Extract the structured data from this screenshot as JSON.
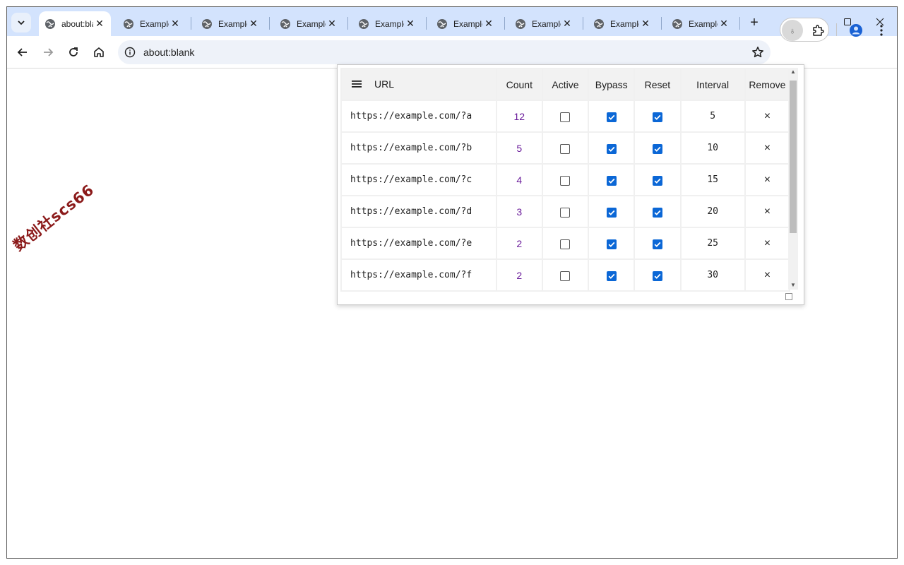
{
  "browser": {
    "tabs": [
      {
        "title": "about:blank",
        "active": true
      },
      {
        "title": "Example Domain",
        "active": false
      },
      {
        "title": "Example Domain",
        "active": false
      },
      {
        "title": "Example Domain",
        "active": false
      },
      {
        "title": "Example Domain",
        "active": false
      },
      {
        "title": "Example Domain",
        "active": false
      },
      {
        "title": "Example Domain",
        "active": false
      },
      {
        "title": "Example Domain",
        "active": false
      },
      {
        "title": "Example Domain",
        "active": false
      }
    ],
    "address": "about:blank",
    "icons": {
      "tab_search": "chevron-down-icon",
      "new_tab": "plus-icon",
      "back": "arrow-left-icon",
      "forward": "arrow-right-icon",
      "reload": "reload-icon",
      "home": "home-icon",
      "site_info": "info-icon",
      "bookmark": "star-icon",
      "extension": "puzzle-icon",
      "profile": "person-icon",
      "menu": "more-vert-icon"
    }
  },
  "watermark": "数创社scs66",
  "popup": {
    "columns": {
      "url": "URL",
      "count": "Count",
      "active": "Active",
      "bypass": "Bypass",
      "reset": "Reset",
      "interval": "Interval",
      "remove": "Remove"
    },
    "rows": [
      {
        "url": "https://example.com/?a",
        "count": "12",
        "active": false,
        "bypass": true,
        "reset": true,
        "interval": "5",
        "remove": "×"
      },
      {
        "url": "https://example.com/?b",
        "count": "5",
        "active": false,
        "bypass": true,
        "reset": true,
        "interval": "10",
        "remove": "×"
      },
      {
        "url": "https://example.com/?c",
        "count": "4",
        "active": false,
        "bypass": true,
        "reset": true,
        "interval": "15",
        "remove": "×"
      },
      {
        "url": "https://example.com/?d",
        "count": "3",
        "active": false,
        "bypass": true,
        "reset": true,
        "interval": "20",
        "remove": "×"
      },
      {
        "url": "https://example.com/?e",
        "count": "2",
        "active": false,
        "bypass": true,
        "reset": true,
        "interval": "25",
        "remove": "×"
      },
      {
        "url": "https://example.com/?f",
        "count": "2",
        "active": false,
        "bypass": true,
        "reset": true,
        "interval": "30",
        "remove": "×"
      }
    ],
    "colors": {
      "count_text": "#6a1b9a",
      "checkbox_checked": "#0b67d6"
    }
  }
}
